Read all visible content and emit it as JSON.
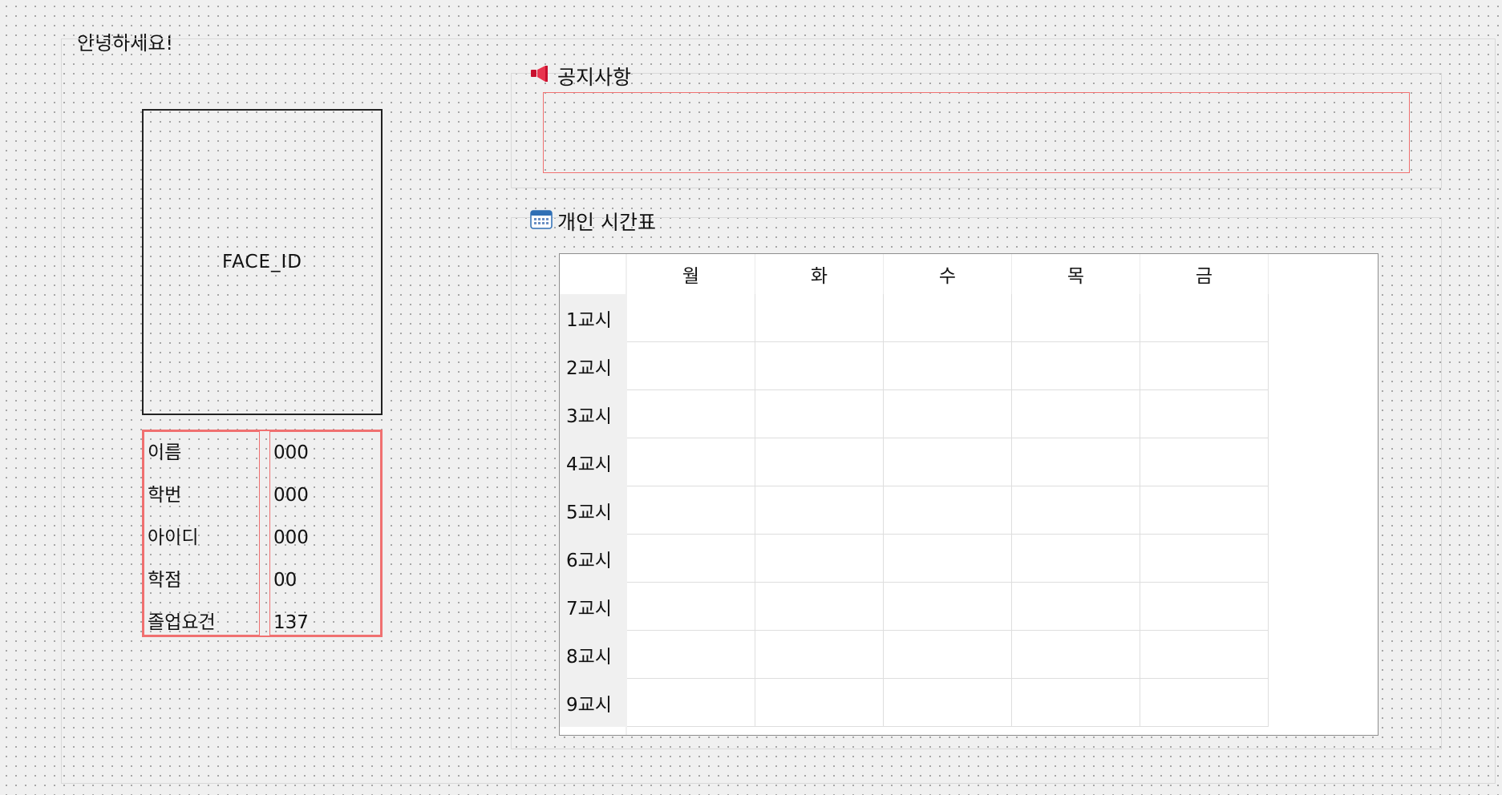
{
  "greeting": "안녕하세요!",
  "profile": {
    "photo_label": "FACE_ID",
    "fields": [
      {
        "label": "이름",
        "value": "000"
      },
      {
        "label": "학번",
        "value": "000"
      },
      {
        "label": "아이디",
        "value": "000"
      },
      {
        "label": "학점",
        "value": "00"
      },
      {
        "label": "졸업요건",
        "value": "137"
      }
    ]
  },
  "notice": {
    "title": "공지사항",
    "icon": "megaphone-icon",
    "content": ""
  },
  "timetable": {
    "title": "개인 시간표",
    "icon": "calendar-icon",
    "days": [
      "월",
      "화",
      "수",
      "목",
      "금"
    ],
    "periods": [
      "1교시",
      "2교시",
      "3교시",
      "4교시",
      "5교시",
      "6교시",
      "7교시",
      "8교시",
      "9교시"
    ]
  },
  "colors": {
    "panel_border": "#f07070",
    "background": "#f0f0f0",
    "icon_red": "#d8203a",
    "icon_blue": "#2f6fb5"
  }
}
